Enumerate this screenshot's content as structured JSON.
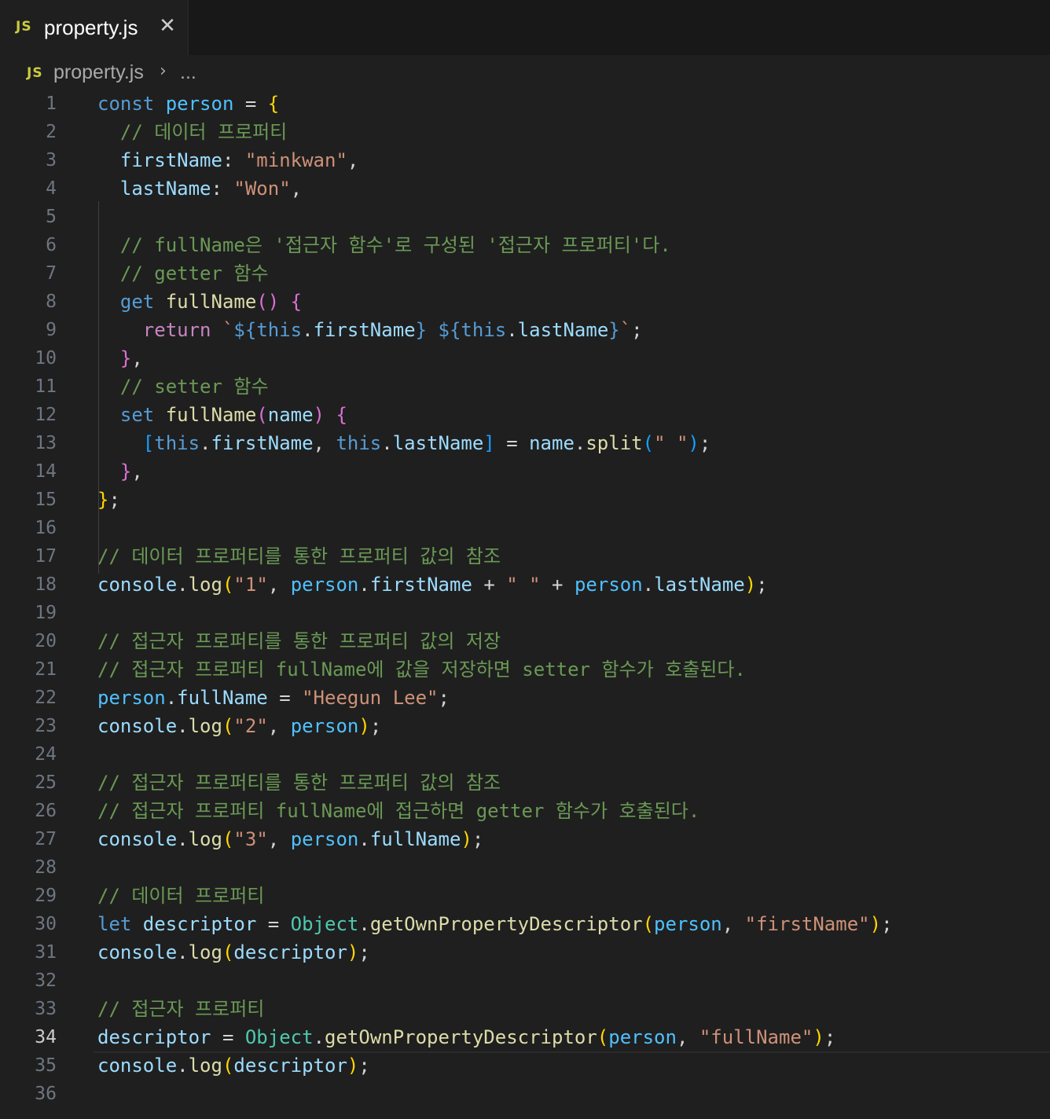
{
  "tab": {
    "badge": "JS",
    "title": "property.js",
    "close": "✕"
  },
  "breadcrumb": {
    "badge": "JS",
    "file": "property.js",
    "separator": "›",
    "more": "..."
  },
  "editor": {
    "current_line": 34,
    "lines": [
      [
        [
          "kw",
          "const "
        ],
        [
          "cst",
          "person"
        ],
        [
          "pn",
          " = "
        ],
        [
          "b1",
          "{"
        ]
      ],
      [
        [
          "pn",
          "  "
        ],
        [
          "cm",
          "// 데이터 프로퍼티"
        ]
      ],
      [
        [
          "pn",
          "  "
        ],
        [
          "var",
          "firstName"
        ],
        [
          "pn",
          ": "
        ],
        [
          "str",
          "\"minkwan\""
        ],
        [
          "pn",
          ","
        ]
      ],
      [
        [
          "pn",
          "  "
        ],
        [
          "var",
          "lastName"
        ],
        [
          "pn",
          ": "
        ],
        [
          "str",
          "\"Won\""
        ],
        [
          "pn",
          ","
        ]
      ],
      [],
      [
        [
          "pn",
          "  "
        ],
        [
          "cm",
          "// fullName은 '접근자 함수'로 구성된 '접근자 프로퍼티'다."
        ]
      ],
      [
        [
          "pn",
          "  "
        ],
        [
          "cm",
          "// getter 함수"
        ]
      ],
      [
        [
          "pn",
          "  "
        ],
        [
          "kw",
          "get "
        ],
        [
          "fn",
          "fullName"
        ],
        [
          "b2",
          "()"
        ],
        [
          "pn",
          " "
        ],
        [
          "b2",
          "{"
        ]
      ],
      [
        [
          "pn",
          "    "
        ],
        [
          "ctl",
          "return "
        ],
        [
          "str",
          "`"
        ],
        [
          "kw",
          "${"
        ],
        [
          "kw",
          "this"
        ],
        [
          "pn",
          "."
        ],
        [
          "var",
          "firstName"
        ],
        [
          "kw",
          "}"
        ],
        [
          "str",
          " "
        ],
        [
          "kw",
          "${"
        ],
        [
          "kw",
          "this"
        ],
        [
          "pn",
          "."
        ],
        [
          "var",
          "lastName"
        ],
        [
          "kw",
          "}"
        ],
        [
          "str",
          "`"
        ],
        [
          "pn",
          ";"
        ]
      ],
      [
        [
          "pn",
          "  "
        ],
        [
          "b2",
          "}"
        ],
        [
          "pn",
          ","
        ]
      ],
      [
        [
          "pn",
          "  "
        ],
        [
          "cm",
          "// setter 함수"
        ]
      ],
      [
        [
          "pn",
          "  "
        ],
        [
          "kw",
          "set "
        ],
        [
          "fn",
          "fullName"
        ],
        [
          "b2",
          "("
        ],
        [
          "var",
          "name"
        ],
        [
          "b2",
          ")"
        ],
        [
          "pn",
          " "
        ],
        [
          "b2",
          "{"
        ]
      ],
      [
        [
          "pn",
          "    "
        ],
        [
          "b3",
          "["
        ],
        [
          "kw",
          "this"
        ],
        [
          "pn",
          "."
        ],
        [
          "var",
          "firstName"
        ],
        [
          "pn",
          ", "
        ],
        [
          "kw",
          "this"
        ],
        [
          "pn",
          "."
        ],
        [
          "var",
          "lastName"
        ],
        [
          "b3",
          "]"
        ],
        [
          "pn",
          " = "
        ],
        [
          "var",
          "name"
        ],
        [
          "pn",
          "."
        ],
        [
          "fn",
          "split"
        ],
        [
          "b3",
          "("
        ],
        [
          "str",
          "\" \""
        ],
        [
          "b3",
          ")"
        ],
        [
          "pn",
          ";"
        ]
      ],
      [
        [
          "pn",
          "  "
        ],
        [
          "b2",
          "}"
        ],
        [
          "pn",
          ","
        ]
      ],
      [
        [
          "b1",
          "}"
        ],
        [
          "pn",
          ";"
        ]
      ],
      [],
      [
        [
          "cm",
          "// 데이터 프로퍼티를 통한 프로퍼티 값의 참조"
        ]
      ],
      [
        [
          "var",
          "console"
        ],
        [
          "pn",
          "."
        ],
        [
          "fn",
          "log"
        ],
        [
          "b1",
          "("
        ],
        [
          "str",
          "\"1\""
        ],
        [
          "pn",
          ", "
        ],
        [
          "cst",
          "person"
        ],
        [
          "pn",
          "."
        ],
        [
          "var",
          "firstName"
        ],
        [
          "pn",
          " + "
        ],
        [
          "str",
          "\" \""
        ],
        [
          "pn",
          " + "
        ],
        [
          "cst",
          "person"
        ],
        [
          "pn",
          "."
        ],
        [
          "var",
          "lastName"
        ],
        [
          "b1",
          ")"
        ],
        [
          "pn",
          ";"
        ]
      ],
      [],
      [
        [
          "cm",
          "// 접근자 프로퍼티를 통한 프로퍼티 값의 저장"
        ]
      ],
      [
        [
          "cm",
          "// 접근자 프로퍼티 fullName에 값을 저장하면 setter 함수가 호출된다."
        ]
      ],
      [
        [
          "cst",
          "person"
        ],
        [
          "pn",
          "."
        ],
        [
          "var",
          "fullName"
        ],
        [
          "pn",
          " = "
        ],
        [
          "str",
          "\"Heegun Lee\""
        ],
        [
          "pn",
          ";"
        ]
      ],
      [
        [
          "var",
          "console"
        ],
        [
          "pn",
          "."
        ],
        [
          "fn",
          "log"
        ],
        [
          "b1",
          "("
        ],
        [
          "str",
          "\"2\""
        ],
        [
          "pn",
          ", "
        ],
        [
          "cst",
          "person"
        ],
        [
          "b1",
          ")"
        ],
        [
          "pn",
          ";"
        ]
      ],
      [],
      [
        [
          "cm",
          "// 접근자 프로퍼티를 통한 프로퍼티 값의 참조"
        ]
      ],
      [
        [
          "cm",
          "// 접근자 프로퍼티 fullName에 접근하면 getter 함수가 호출된다."
        ]
      ],
      [
        [
          "var",
          "console"
        ],
        [
          "pn",
          "."
        ],
        [
          "fn",
          "log"
        ],
        [
          "b1",
          "("
        ],
        [
          "str",
          "\"3\""
        ],
        [
          "pn",
          ", "
        ],
        [
          "cst",
          "person"
        ],
        [
          "pn",
          "."
        ],
        [
          "var",
          "fullName"
        ],
        [
          "b1",
          ")"
        ],
        [
          "pn",
          ";"
        ]
      ],
      [],
      [
        [
          "cm",
          "// 데이터 프로퍼티"
        ]
      ],
      [
        [
          "kw",
          "let "
        ],
        [
          "var",
          "descriptor"
        ],
        [
          "pn",
          " = "
        ],
        [
          "cls",
          "Object"
        ],
        [
          "pn",
          "."
        ],
        [
          "fn",
          "getOwnPropertyDescriptor"
        ],
        [
          "b1",
          "("
        ],
        [
          "cst",
          "person"
        ],
        [
          "pn",
          ", "
        ],
        [
          "str",
          "\"firstName\""
        ],
        [
          "b1",
          ")"
        ],
        [
          "pn",
          ";"
        ]
      ],
      [
        [
          "var",
          "console"
        ],
        [
          "pn",
          "."
        ],
        [
          "fn",
          "log"
        ],
        [
          "b1",
          "("
        ],
        [
          "var",
          "descriptor"
        ],
        [
          "b1",
          ")"
        ],
        [
          "pn",
          ";"
        ]
      ],
      [],
      [
        [
          "cm",
          "// 접근자 프로퍼티"
        ]
      ],
      [
        [
          "var",
          "descriptor"
        ],
        [
          "pn",
          " = "
        ],
        [
          "cls",
          "Object"
        ],
        [
          "pn",
          "."
        ],
        [
          "fn",
          "getOwnPropertyDescriptor"
        ],
        [
          "b1",
          "("
        ],
        [
          "cst",
          "person"
        ],
        [
          "pn",
          ", "
        ],
        [
          "str",
          "\"fullName\""
        ],
        [
          "b1",
          ")"
        ],
        [
          "pn",
          ";"
        ]
      ],
      [
        [
          "var",
          "console"
        ],
        [
          "pn",
          "."
        ],
        [
          "fn",
          "log"
        ],
        [
          "b1",
          "("
        ],
        [
          "var",
          "descriptor"
        ],
        [
          "b1",
          ")"
        ],
        [
          "pn",
          ";"
        ]
      ],
      []
    ]
  }
}
